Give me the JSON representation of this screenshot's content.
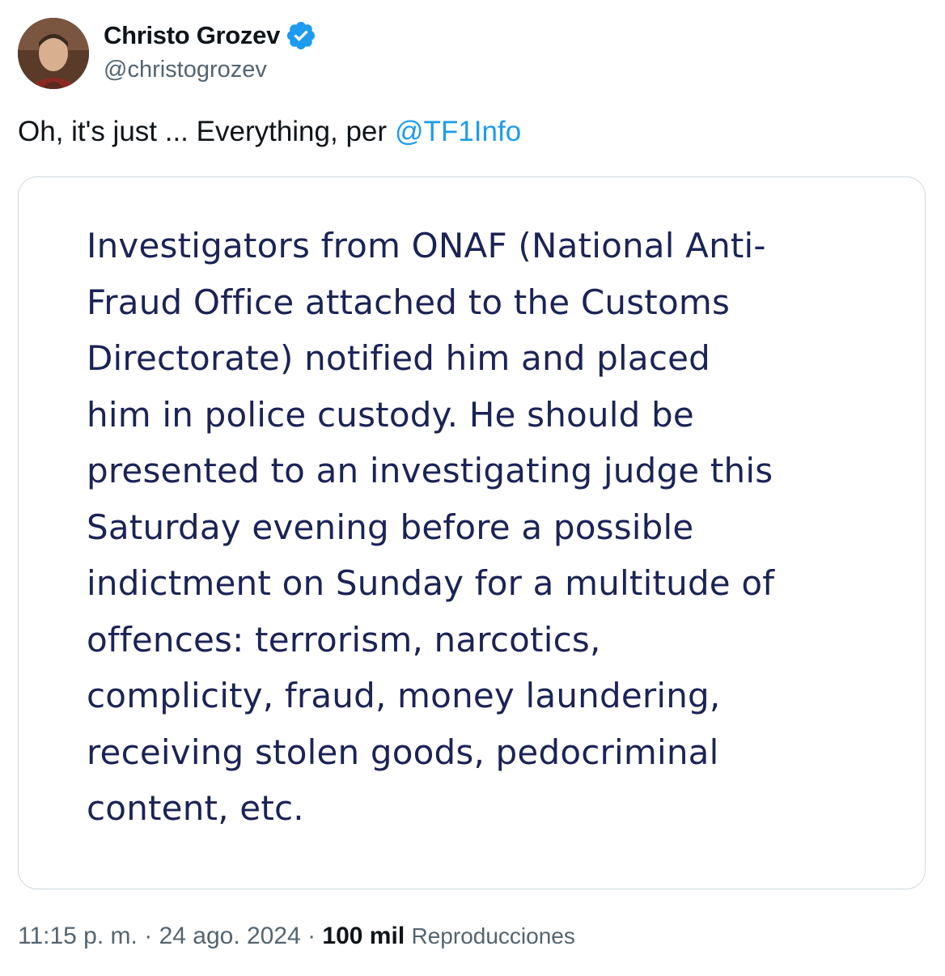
{
  "author": {
    "display_name": "Christo Grozev",
    "handle": "@christogrozev",
    "avatar_icon": "profile-photo",
    "verified_icon": "verified-badge-icon",
    "verified_color": "#1d9bf0"
  },
  "tweet": {
    "text": "Oh, it's just ... Everything, per",
    "mention": "@TF1Info",
    "mention_color": "#1d9bf0"
  },
  "quote": {
    "lines": [
      "Investigators from ONAF (National Anti-",
      "Fraud Office attached to the Customs",
      "Directorate) notified him and placed",
      "him in police custody. He should be",
      "presented to an investigating judge this",
      "Saturday evening before a possible",
      "indictment on Sunday for a multitude of",
      "offences: terrorism, narcotics,",
      "complicity, fraud, money laundering,",
      "receiving stolen goods, pedocriminal",
      "content, etc."
    ],
    "text_color": "#1b2356"
  },
  "meta": {
    "time": "11:15 p. m.",
    "separator": "·",
    "date": "24 ago. 2024",
    "views_count": "100 mil",
    "views_label": "Reproducciones"
  }
}
